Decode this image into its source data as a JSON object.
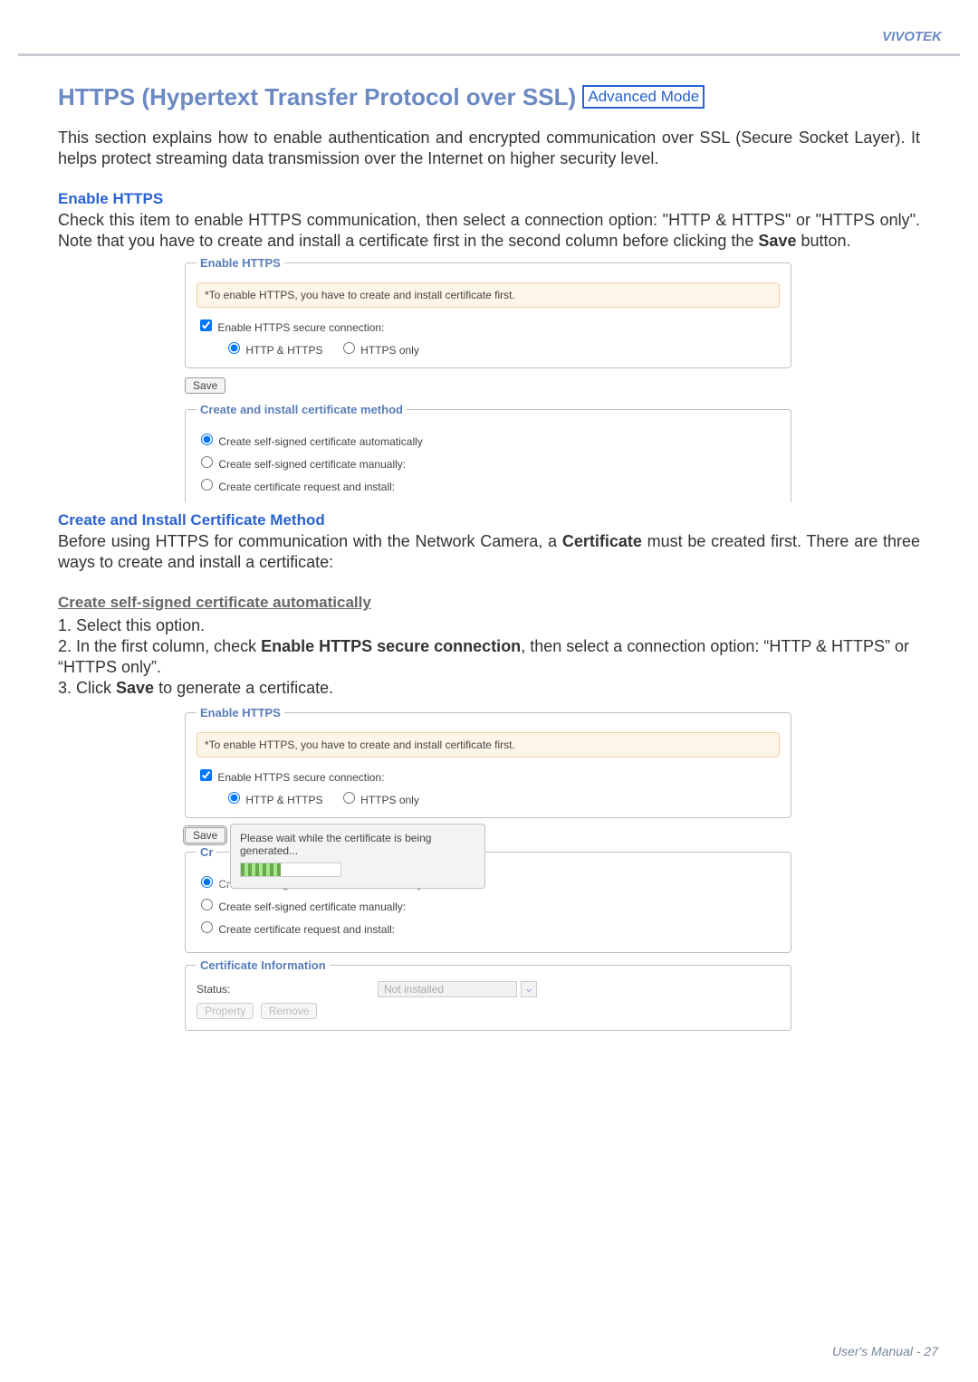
{
  "header": {
    "brand": "VIVOTEK"
  },
  "title": {
    "main": "HTTPS (Hypertext Transfer Protocol over SSL)",
    "badge": "Advanced Mode"
  },
  "intro": "This section explains how to enable authentication and encrypted communication over SSL (Secure Socket Layer). It helps protect streaming data transmission over the Internet on higher security level.",
  "sections": {
    "enable": {
      "heading": "Enable HTTPS",
      "body_a": "Check this item to enable HTTPS communication, then select a connection option: \"HTTP & HTTPS\" or \"HTTPS only\". Note that you have to create and install a certificate first in the second column before clicking the ",
      "body_bold": "Save",
      "body_b": " button."
    },
    "cert_method": {
      "heading": "Create and Install Certificate Method",
      "body_a": "Before using HTTPS for communication with the Network Camera, a ",
      "body_bold": "Certificate",
      "body_b": " must be created first. There are three ways to create and install a certificate:",
      "subheading": "Create self-signed certificate automatically",
      "steps": {
        "s1": "1. Select this option.",
        "s2a": "2. In the first column, check ",
        "s2bold": "Enable HTTPS secure connection",
        "s2b": ", then select a connection option: “HTTP & HTTPS” or “HTTPS only”.",
        "s2indent": "",
        "s3a": "3. Click ",
        "s3bold": "Save",
        "s3b": " to generate a certificate."
      }
    }
  },
  "ui": {
    "fieldset_enable_legend": "Enable HTTPS",
    "note": "*To enable HTTPS, you have to create and install certificate first.",
    "checkbox_label": "Enable HTTPS secure connection:",
    "radio_http_https": "HTTP & HTTPS",
    "radio_https_only": "HTTPS only",
    "save": "Save",
    "fieldset_method_legend": "Create and install certificate method",
    "opt_auto": "Create self-signed certificate automatically",
    "opt_manual": "Create self-signed certificate manually:",
    "opt_request": "Create certificate request and install:",
    "dialog_line1": "Please wait while the certificate is being",
    "dialog_line2": "generated...",
    "legend_clipped_prefix": "Cr",
    "fieldset_certinfo_legend": "Certificate Information",
    "status_label": "Status:",
    "status_value": "Not installed",
    "btn_property": "Property",
    "btn_remove": "Remove"
  },
  "footer": {
    "label": "User's Manual - ",
    "page": "27"
  }
}
